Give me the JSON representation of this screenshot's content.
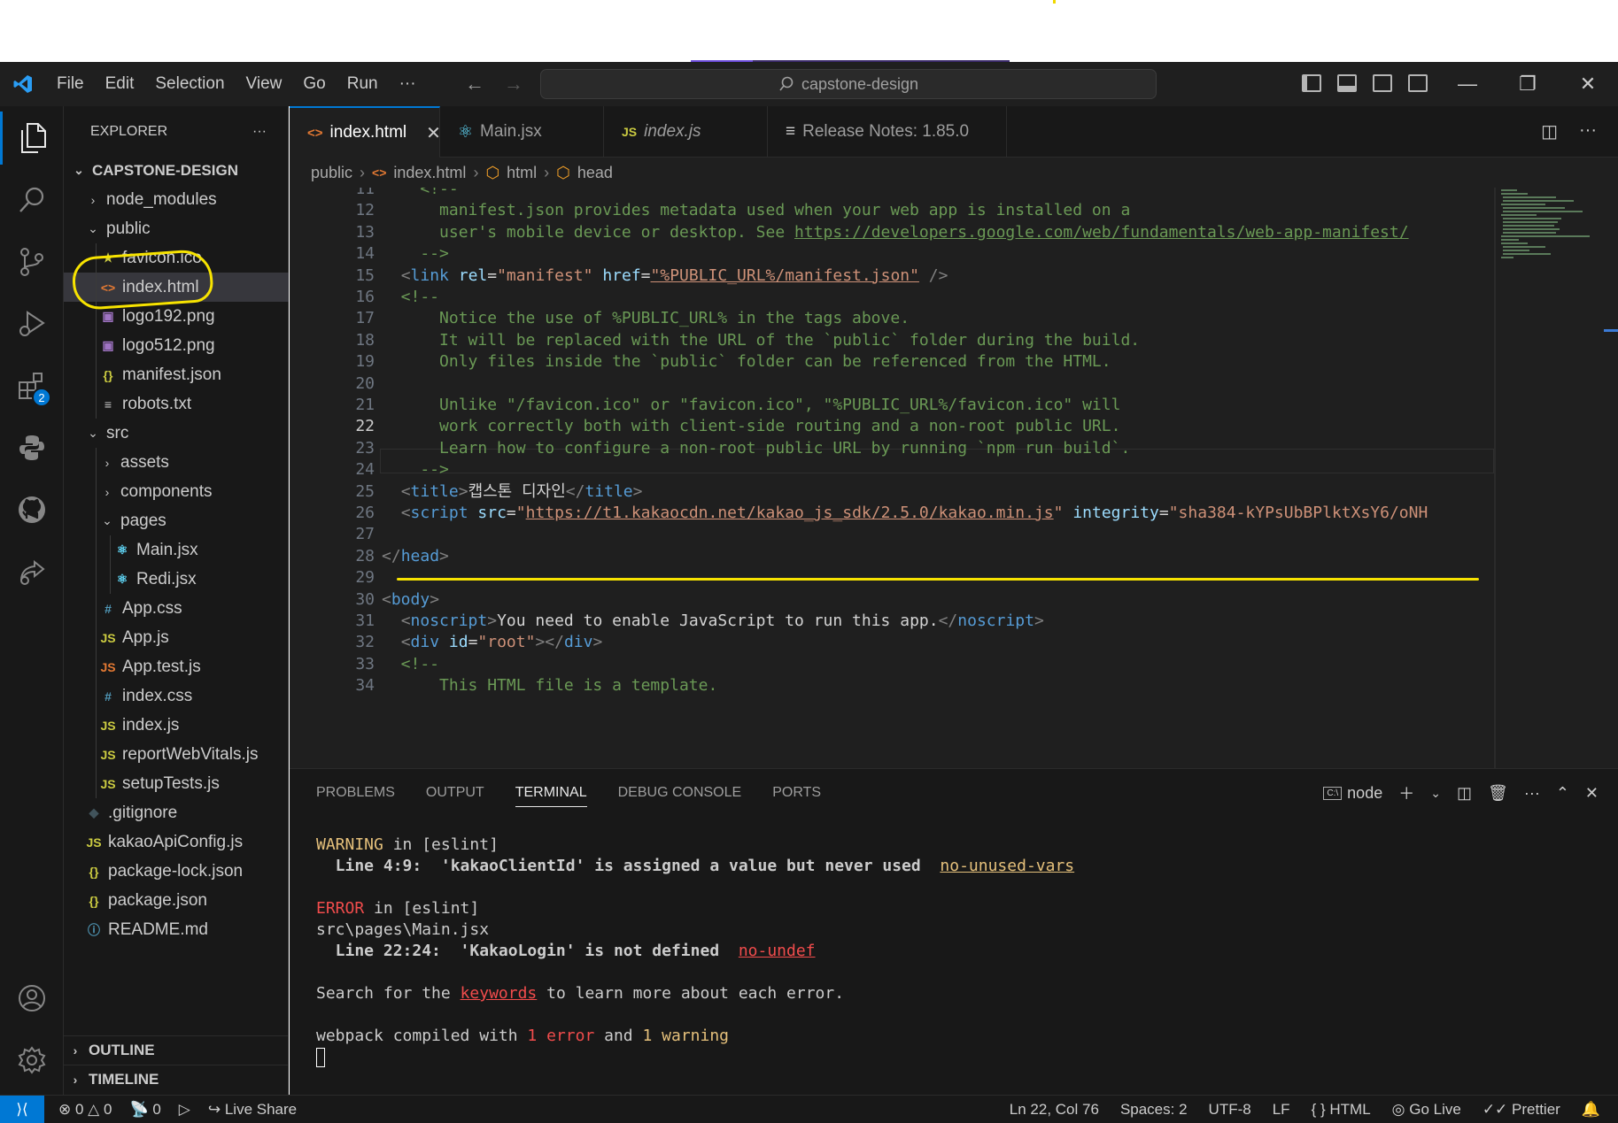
{
  "menu": [
    "File",
    "Edit",
    "Selection",
    "View",
    "Go",
    "Run",
    "···"
  ],
  "search": {
    "text": "capstone-design"
  },
  "sidebar": {
    "title": "EXPLORER",
    "more": "···",
    "project": "CAPSTONE-DESIGN",
    "items": [
      {
        "label": "node_modules",
        "type": "folder",
        "depth": 1,
        "open": false
      },
      {
        "label": "public",
        "type": "folder",
        "depth": 1,
        "open": true
      },
      {
        "label": "favicon.ico",
        "type": "star",
        "depth": 2
      },
      {
        "label": "index.html",
        "type": "html",
        "depth": 2,
        "selected": true
      },
      {
        "label": "logo192.png",
        "type": "image",
        "depth": 2
      },
      {
        "label": "logo512.png",
        "type": "image",
        "depth": 2
      },
      {
        "label": "manifest.json",
        "type": "json",
        "depth": 2
      },
      {
        "label": "robots.txt",
        "type": "text",
        "depth": 2
      },
      {
        "label": "src",
        "type": "folder",
        "depth": 1,
        "open": true
      },
      {
        "label": "assets",
        "type": "folder",
        "depth": 2,
        "open": false
      },
      {
        "label": "components",
        "type": "folder",
        "depth": 2,
        "open": false
      },
      {
        "label": "pages",
        "type": "folder",
        "depth": 2,
        "open": true
      },
      {
        "label": "Main.jsx",
        "type": "react",
        "depth": 3
      },
      {
        "label": "Redi.jsx",
        "type": "react",
        "depth": 3
      },
      {
        "label": "App.css",
        "type": "css",
        "depth": 2
      },
      {
        "label": "App.js",
        "type": "js",
        "depth": 2
      },
      {
        "label": "App.test.js",
        "type": "jstest",
        "depth": 2
      },
      {
        "label": "index.css",
        "type": "css",
        "depth": 2
      },
      {
        "label": "index.js",
        "type": "js",
        "depth": 2
      },
      {
        "label": "reportWebVitals.js",
        "type": "js",
        "depth": 2
      },
      {
        "label": "setupTests.js",
        "type": "js",
        "depth": 2
      },
      {
        "label": ".gitignore",
        "type": "git",
        "depth": 1
      },
      {
        "label": "kakaoApiConfig.js",
        "type": "js",
        "depth": 1
      },
      {
        "label": "package-lock.json",
        "type": "json",
        "depth": 1
      },
      {
        "label": "package.json",
        "type": "json",
        "depth": 1
      },
      {
        "label": "README.md",
        "type": "info",
        "depth": 1
      }
    ],
    "outline": "OUTLINE",
    "timeline": "TIMELINE"
  },
  "activity": {
    "extensions_badge": "2"
  },
  "tabs": [
    {
      "label": "index.html",
      "icon": "<>",
      "active": true
    },
    {
      "label": "Main.jsx",
      "icon": "react"
    },
    {
      "label": "index.js",
      "icon": "JS",
      "italic": true
    },
    {
      "label": "Release Notes: 1.85.0",
      "icon": "notes"
    }
  ],
  "breadcrumb": [
    "public",
    "index.html",
    "html",
    "head"
  ],
  "editor": {
    "current_line": "22",
    "lines": [
      {
        "n": "11",
        "tokens": [
          [
            "cm",
            "    <!--"
          ]
        ]
      },
      {
        "n": "12",
        "tokens": [
          [
            "cm",
            "      manifest.json provides metadata used when your web app is installed on a"
          ]
        ]
      },
      {
        "n": "13",
        "tokens": [
          [
            "cm",
            "      user's mobile device or desktop. See "
          ],
          [
            "cmlink",
            "https://developers.google.com/web/fundamentals/web-app-manifest/"
          ]
        ]
      },
      {
        "n": "14",
        "tokens": [
          [
            "cm",
            "    -->"
          ]
        ]
      },
      {
        "n": "15",
        "tokens": [
          [
            "txt",
            "  "
          ],
          [
            "br",
            "<"
          ],
          [
            "tag",
            "link"
          ],
          [
            "txt",
            " "
          ],
          [
            "attr",
            "rel"
          ],
          [
            "txt",
            "="
          ],
          [
            "str",
            "\"manifest\""
          ],
          [
            "txt",
            " "
          ],
          [
            "attr",
            "href"
          ],
          [
            "txt",
            "="
          ],
          [
            "strlink",
            "\"%PUBLIC_URL%/manifest.json\""
          ],
          [
            "txt",
            " "
          ],
          [
            "br",
            "/>"
          ]
        ]
      },
      {
        "n": "16",
        "tokens": [
          [
            "cm",
            "  <!--"
          ]
        ]
      },
      {
        "n": "17",
        "tokens": [
          [
            "cm",
            "      Notice the use of %PUBLIC_URL% in the tags above."
          ]
        ]
      },
      {
        "n": "18",
        "tokens": [
          [
            "cm",
            "      It will be replaced with the URL of the `public` folder during the build."
          ]
        ]
      },
      {
        "n": "19",
        "tokens": [
          [
            "cm",
            "      Only files inside the `public` folder can be referenced from the HTML."
          ]
        ]
      },
      {
        "n": "20",
        "tokens": []
      },
      {
        "n": "21",
        "tokens": [
          [
            "cm",
            "      Unlike \"/favicon.ico\" or \"favicon.ico\", \"%PUBLIC_URL%/favicon.ico\" will"
          ]
        ]
      },
      {
        "n": "22",
        "tokens": [
          [
            "cm",
            "      work correctly both with client-side routing and a non-root public URL."
          ]
        ]
      },
      {
        "n": "23",
        "tokens": [
          [
            "cm",
            "      Learn how to configure a non-root public URL by running `npm run build`."
          ]
        ]
      },
      {
        "n": "24",
        "tokens": [
          [
            "cm",
            "    -->"
          ]
        ]
      },
      {
        "n": "25",
        "tokens": [
          [
            "txt",
            "  "
          ],
          [
            "br",
            "<"
          ],
          [
            "tag",
            "title"
          ],
          [
            "br",
            ">"
          ],
          [
            "txt",
            "캡스톤 디자인"
          ],
          [
            "br",
            "</"
          ],
          [
            "tag",
            "title"
          ],
          [
            "br",
            ">"
          ]
        ]
      },
      {
        "n": "26",
        "tokens": [
          [
            "txt",
            "  "
          ],
          [
            "br",
            "<"
          ],
          [
            "tag",
            "script"
          ],
          [
            "txt",
            " "
          ],
          [
            "attr",
            "src"
          ],
          [
            "txt",
            "="
          ],
          [
            "str",
            "\""
          ],
          [
            "strlink",
            "https://t1.kakaocdn.net/kakao_js_sdk/2.5.0/kakao.min.js"
          ],
          [
            "str",
            "\""
          ],
          [
            "txt",
            " "
          ],
          [
            "attr",
            "integrity"
          ],
          [
            "txt",
            "="
          ],
          [
            "str",
            "\"sha384-kYPsUbBPlktXsY6/oNH"
          ]
        ]
      },
      {
        "n": "27",
        "tokens": []
      },
      {
        "n": "28",
        "tokens": [
          [
            "br",
            "</"
          ],
          [
            "tag",
            "head"
          ],
          [
            "br",
            ">"
          ]
        ]
      },
      {
        "n": "29",
        "tokens": []
      },
      {
        "n": "30",
        "tokens": [
          [
            "br",
            "<"
          ],
          [
            "tag",
            "body"
          ],
          [
            "br",
            ">"
          ]
        ]
      },
      {
        "n": "31",
        "tokens": [
          [
            "txt",
            "  "
          ],
          [
            "br",
            "<"
          ],
          [
            "tag",
            "noscript"
          ],
          [
            "br",
            ">"
          ],
          [
            "txt",
            "You need to enable JavaScript to run this app."
          ],
          [
            "br",
            "</"
          ],
          [
            "tag",
            "noscript"
          ],
          [
            "br",
            ">"
          ]
        ]
      },
      {
        "n": "32",
        "tokens": [
          [
            "txt",
            "  "
          ],
          [
            "br",
            "<"
          ],
          [
            "tag",
            "div"
          ],
          [
            "txt",
            " "
          ],
          [
            "attr",
            "id"
          ],
          [
            "txt",
            "="
          ],
          [
            "str",
            "\"root\""
          ],
          [
            "br",
            "></"
          ],
          [
            "tag",
            "div"
          ],
          [
            "br",
            ">"
          ]
        ]
      },
      {
        "n": "33",
        "tokens": [
          [
            "cm",
            "  <!--"
          ]
        ]
      },
      {
        "n": "34",
        "tokens": [
          [
            "cm",
            "      This HTML file is a template."
          ]
        ]
      }
    ]
  },
  "panel": {
    "tabs": [
      "PROBLEMS",
      "OUTPUT",
      "TERMINAL",
      "DEBUG CONSOLE",
      "PORTS"
    ],
    "active_tab": "TERMINAL",
    "shell": "node",
    "terminal": {
      "warn_word": "WARNING",
      "warn_rest": " in [eslint]",
      "warn_line": "  Line 4:9:  'kakaoClientId' is assigned a value but never used  ",
      "warn_rule": "no-unused-vars",
      "err_word": "ERROR",
      "err_rest": " in [eslint]",
      "err_file": "src\\pages\\Main.jsx",
      "err_line": "  Line 22:24:  'KakaoLogin' is not defined  ",
      "err_rule": "no-undef",
      "search_pre": "Search for the ",
      "search_kw": "keywords",
      "search_post": " to learn more about each error.",
      "compiled_pre": "webpack compiled with ",
      "compiled_n1": "1",
      "compiled_err": " error",
      "compiled_and": " and ",
      "compiled_n2": "1",
      "compiled_warn": " warning"
    }
  },
  "status": {
    "errors": "0",
    "warnings": "0",
    "ports": "0",
    "live_share": "Live Share",
    "position": "Ln 22, Col 76",
    "spaces": "Spaces: 2",
    "encoding": "UTF-8",
    "eol": "LF",
    "language": "HTML",
    "go_live": "Go Live",
    "prettier": "Prettier"
  },
  "colors": {
    "accent": "#0078d4",
    "annotation": "#f7e300",
    "tag": "#569cd6",
    "attr": "#9cdcfe",
    "string": "#ce9178",
    "comment": "#6a9955"
  }
}
